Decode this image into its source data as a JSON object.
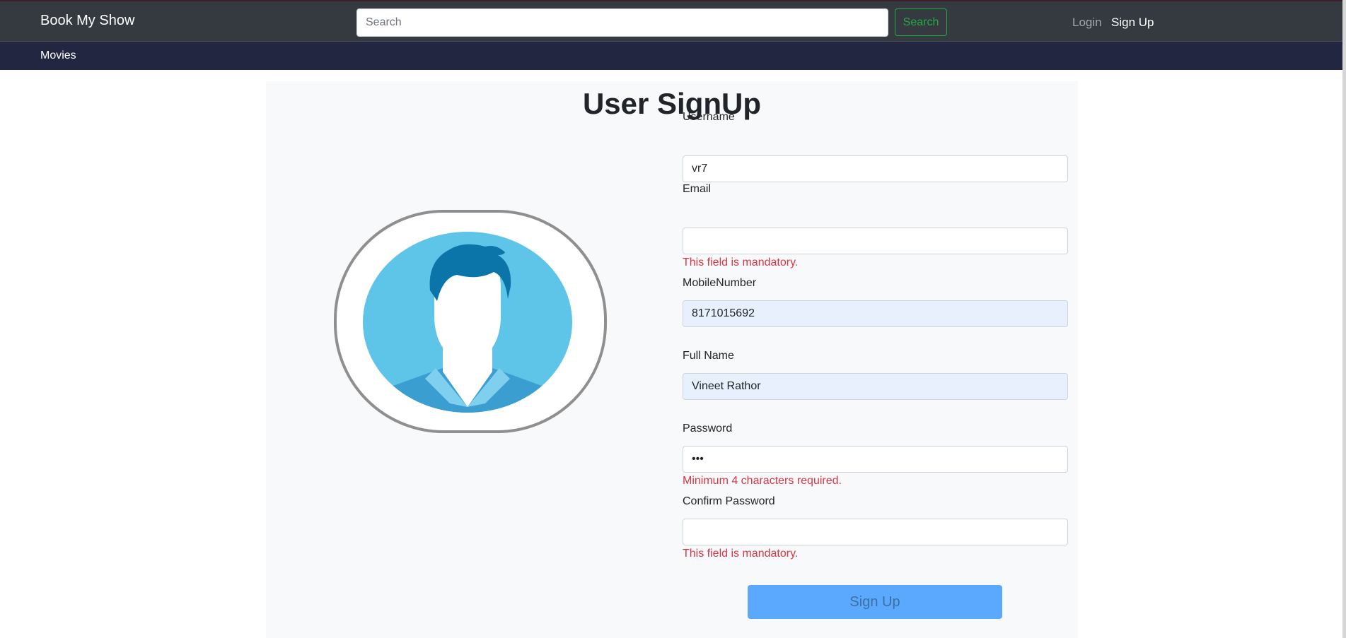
{
  "navbar": {
    "brand": "Book My Show",
    "search_placeholder": "Search",
    "search_button": "Search",
    "login": "Login",
    "signup": "Sign Up"
  },
  "subnav": {
    "movies": "Movies"
  },
  "form": {
    "title": "User SignUp",
    "username": {
      "label": "Username",
      "value": "vr7"
    },
    "email": {
      "label": "Email",
      "value": "",
      "error": "This field is mandatory."
    },
    "mobile": {
      "label": "MobileNumber",
      "value": "8171015692"
    },
    "fullname": {
      "label": "Full Name",
      "value": "Vineet Rathor"
    },
    "password": {
      "label": "Password",
      "value": "abc",
      "error": "Minimum 4 characters required."
    },
    "confirm": {
      "label": "Confirm Password",
      "value": "",
      "error": "This field is mandatory."
    },
    "submit": "Sign Up"
  },
  "colors": {
    "navbar": "#343a40",
    "subnav": "#232640",
    "search_accent": "#28a745",
    "error": "#dc3545",
    "submit": "#5aa9ff",
    "avatar_bg": "#5ec4e8",
    "avatar_hair": "#0b74a8"
  },
  "icons": {
    "avatar": "user-avatar-icon"
  }
}
